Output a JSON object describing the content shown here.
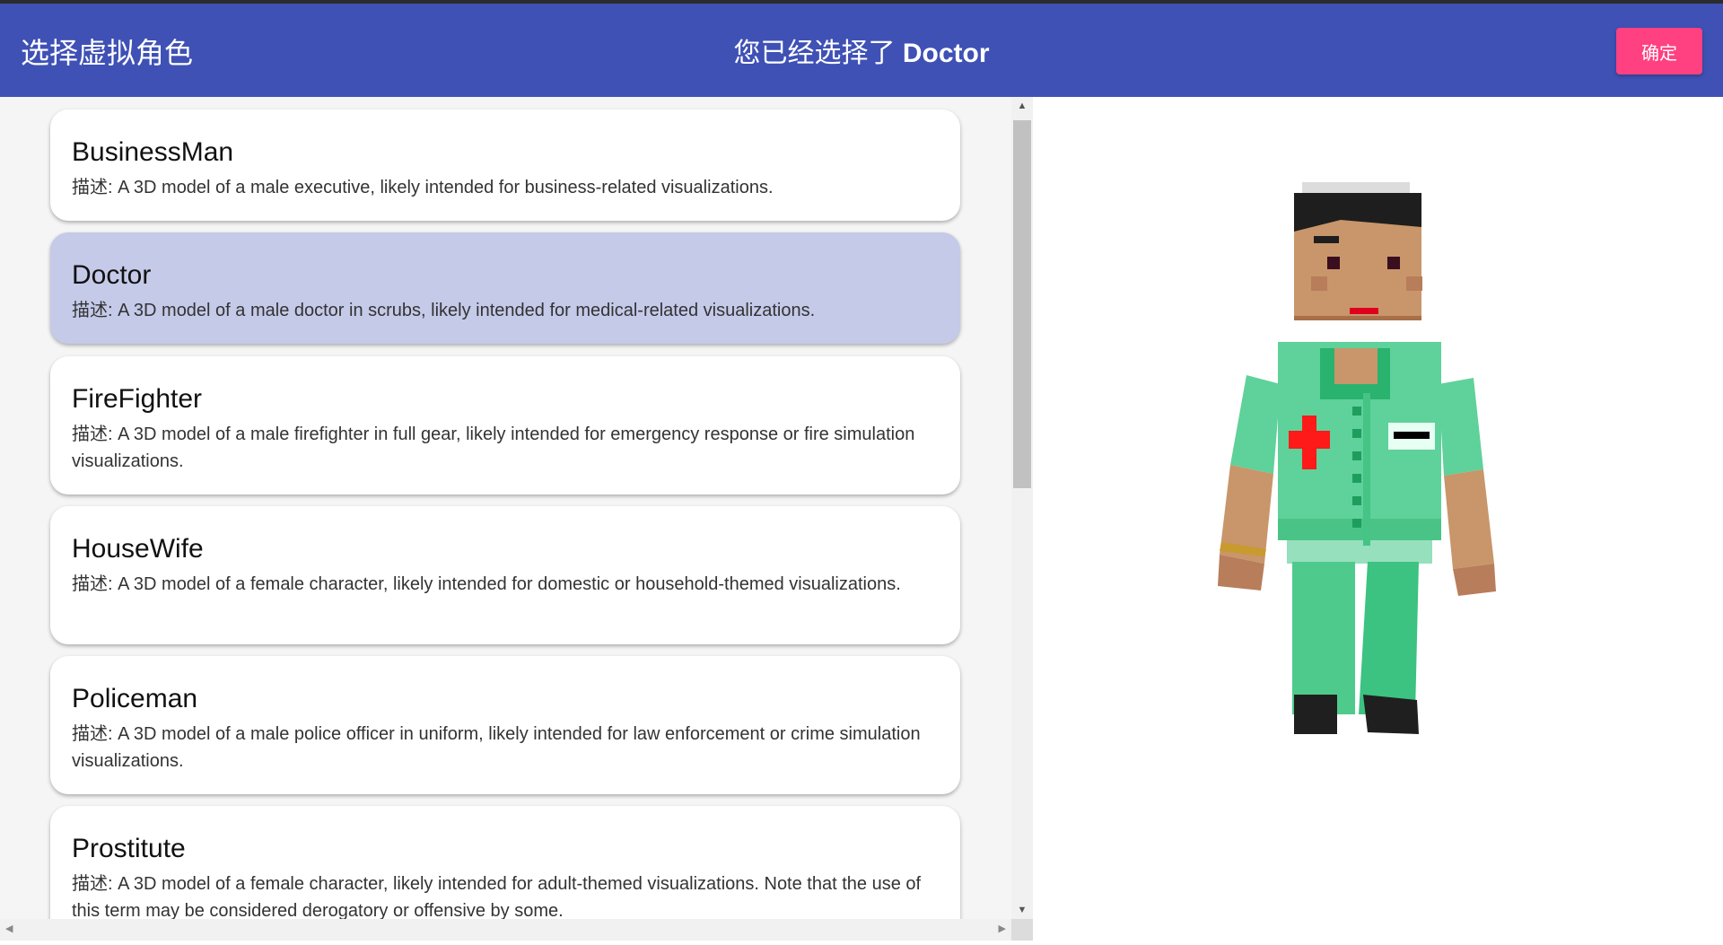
{
  "header": {
    "app_title": "选择虚拟角色",
    "selection_prefix": "您已经选择了 ",
    "selected_name": "Doctor",
    "confirm_label": "确定"
  },
  "characters": [
    {
      "name": "BusinessMan",
      "desc": "描述: A 3D model of a male executive, likely intended for business-related visualizations."
    },
    {
      "name": "Doctor",
      "desc": "描述: A 3D model of a male doctor in scrubs, likely intended for medical-related visualizations.",
      "selected": true
    },
    {
      "name": "FireFighter",
      "desc": "描述: A 3D model of a male firefighter in full gear, likely intended for emergency response or fire simulation visualizations."
    },
    {
      "name": "HouseWife",
      "desc": "描述: A 3D model of a female character, likely intended for domestic or household-themed visualizations."
    },
    {
      "name": "Policeman",
      "desc": "描述: A 3D model of a male police officer in uniform, likely intended for law enforcement or crime simulation visualizations."
    },
    {
      "name": "Prostitute",
      "desc": "描述: A 3D model of a female character, likely intended for adult-themed visualizations. Note that the use of this term may be considered derogatory or offensive by some."
    }
  ],
  "colors": {
    "header_bg": "#3f51b5",
    "accent": "#ff4081",
    "selected_card": "#c5cae9",
    "scrubs": "#5fd19a",
    "skin": "#c8966a",
    "hair": "#1e1e1e",
    "cross": "#ff1a1a"
  },
  "viewer": {
    "model_icon": "doctor-voxel-character"
  }
}
